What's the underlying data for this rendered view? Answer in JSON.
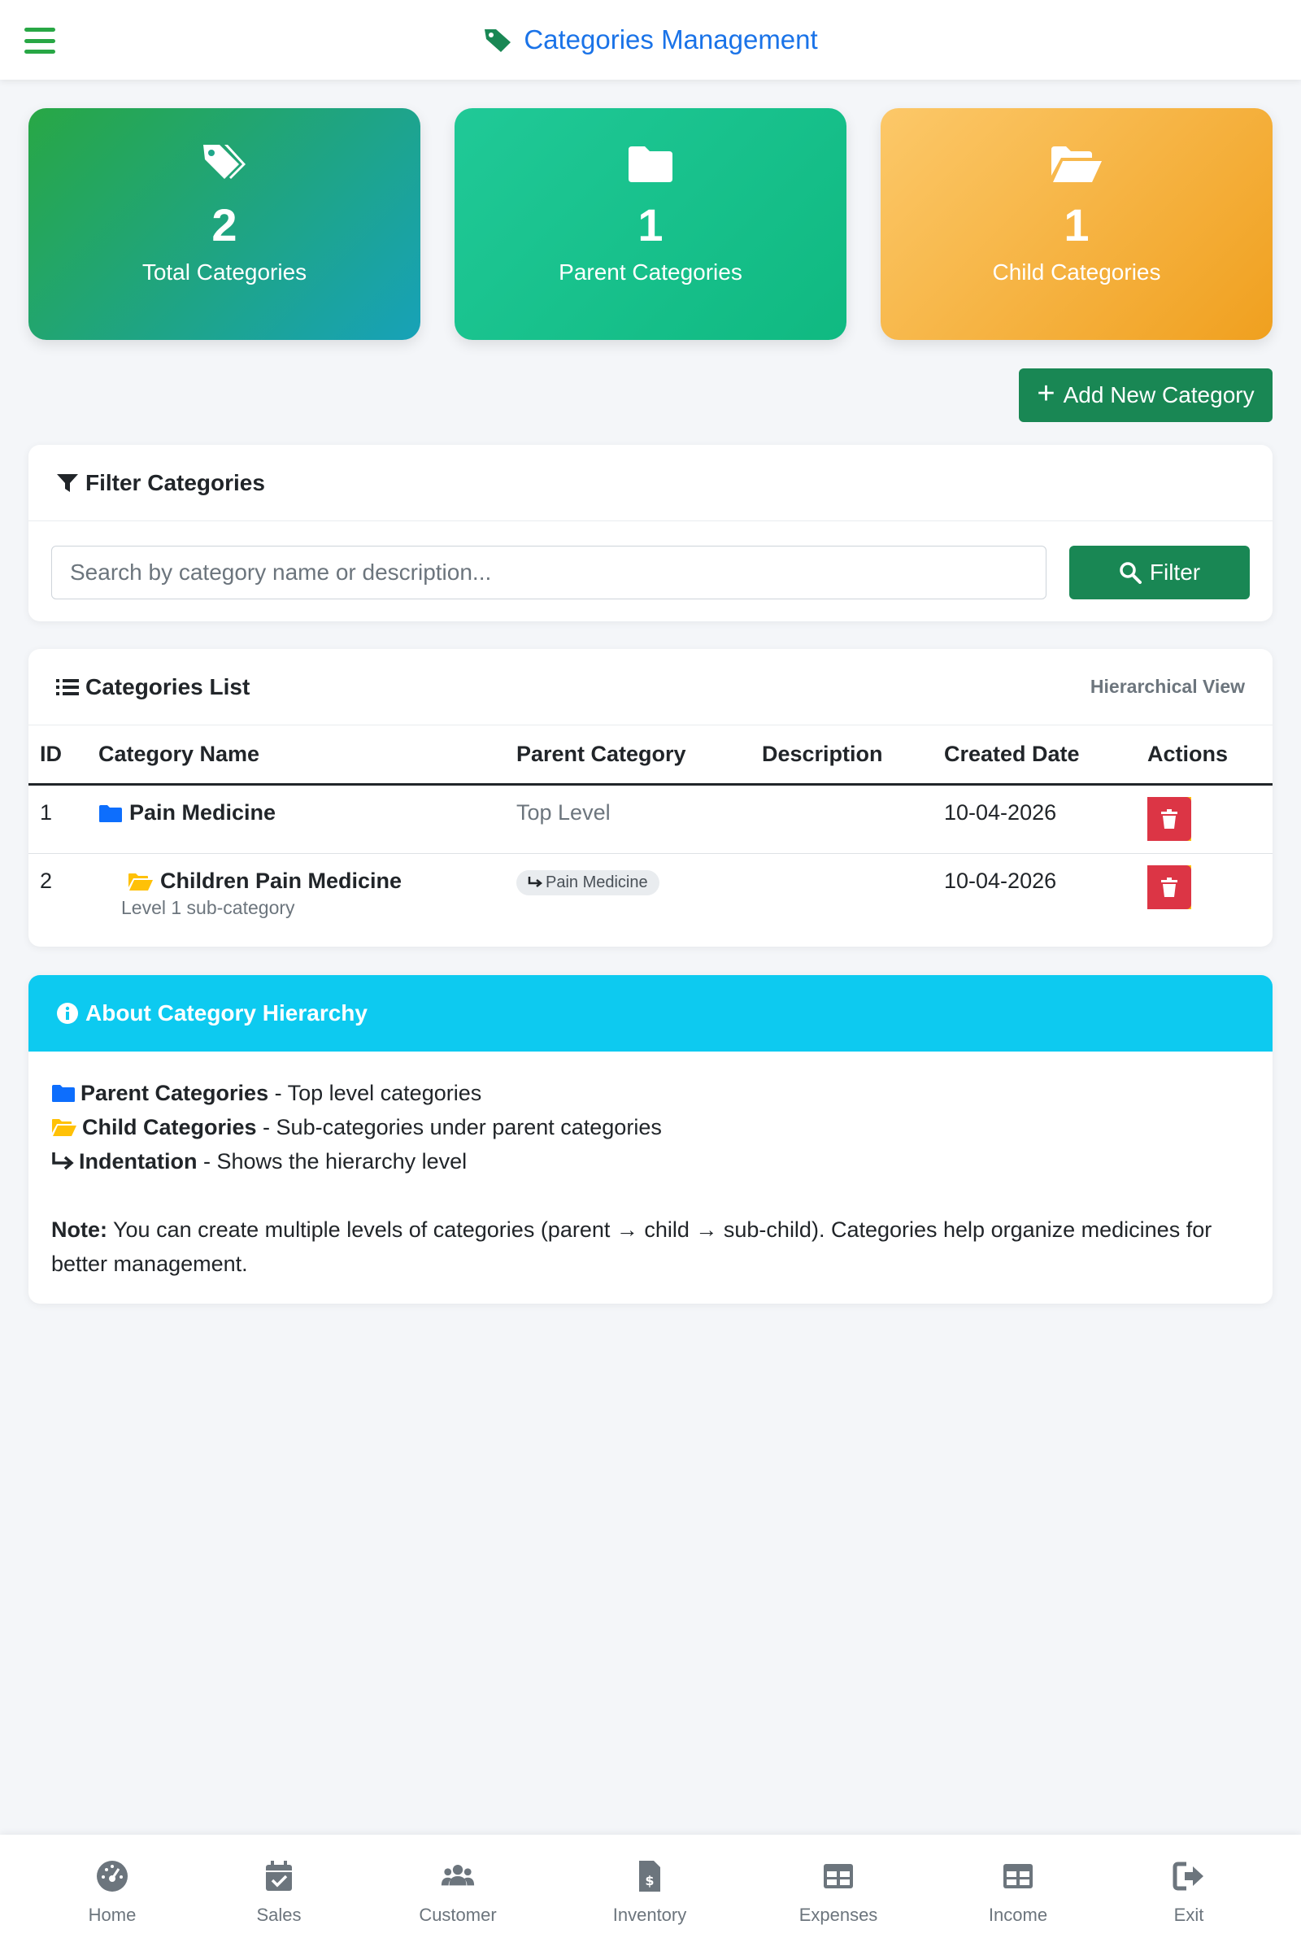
{
  "header": {
    "title": "Categories Management"
  },
  "stats": [
    {
      "value": "2",
      "label": "Total Categories",
      "icon": "tags-icon"
    },
    {
      "value": "1",
      "label": "Parent Categories",
      "icon": "folder-icon"
    },
    {
      "value": "1",
      "label": "Child Categories",
      "icon": "folder-open-icon"
    }
  ],
  "actions": {
    "add_label": "Add New Category"
  },
  "filter": {
    "title": "Filter Categories",
    "placeholder": "Search by category name or description...",
    "button_label": "Filter"
  },
  "list": {
    "title": "Categories List",
    "view_label": "Hierarchical View",
    "columns": [
      "ID",
      "Category Name",
      "Parent Category",
      "Description",
      "Created Date",
      "Actions"
    ],
    "rows": [
      {
        "id": "1",
        "name": "Pain Medicine",
        "parent": "Top Level",
        "description": "",
        "created": "10-04-2026"
      },
      {
        "id": "2",
        "name": "Children Pain Medicine",
        "sub_label": "Level 1 sub-category",
        "parent": "Pain Medicine",
        "description": "",
        "created": "10-04-2026"
      }
    ]
  },
  "about": {
    "title": "About Category Hierarchy",
    "items": [
      {
        "term": "Parent Categories",
        "desc": " - Top level categories"
      },
      {
        "term": "Child Categories",
        "desc": " - Sub-categories under parent categories"
      },
      {
        "term": "Indentation",
        "desc": " - Shows the hierarchy level"
      }
    ],
    "note_label": "Note:",
    "note_text": " You can create multiple levels of categories (parent → child → sub-child). Categories help organize medicines for better management."
  },
  "bottom_nav": [
    {
      "label": "Home",
      "icon": "dashboard-icon"
    },
    {
      "label": "Sales",
      "icon": "calendar-check-icon"
    },
    {
      "label": "Customer",
      "icon": "users-icon"
    },
    {
      "label": "Inventory",
      "icon": "invoice-icon"
    },
    {
      "label": "Expenses",
      "icon": "table-icon"
    },
    {
      "label": "Income",
      "icon": "table-icon"
    },
    {
      "label": "Exit",
      "icon": "sign-out-icon"
    }
  ],
  "colors": {
    "primary_green": "#198754",
    "title_blue": "#1a73e8",
    "info": "#0dcaf0",
    "warning": "#ffc107",
    "danger": "#dc3545"
  }
}
